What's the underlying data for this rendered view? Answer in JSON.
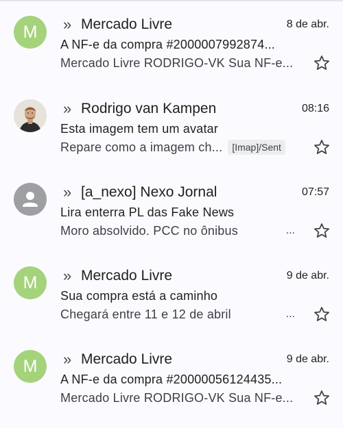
{
  "emails": [
    {
      "avatar_letter": "M",
      "forward_glyph": "»",
      "sender": "Mercado Livre",
      "date": "8 de abr.",
      "subject": "A NF-e da compra #2000007992874...",
      "snippet": "Mercado Livre RODRIGO-VK Sua NF-e...",
      "icon": "star-outline-icon"
    },
    {
      "forward_glyph": "»",
      "sender": "Rodrigo van Kampen",
      "date": "08:16",
      "subject": "Esta imagem tem um avatar",
      "snippet": "Repare como a imagem ch...",
      "label": "[Imap]/Sent",
      "icon": "star-outline-icon"
    },
    {
      "forward_glyph": "»",
      "sender": "[a_nexo] Nexo Jornal",
      "date": "07:57",
      "subject": "Lira enterra PL das Fake News",
      "snippet": "Moro absolvido. PCC no ônibus",
      "ellipsis": "...",
      "icon": "star-outline-icon"
    },
    {
      "avatar_letter": "M",
      "forward_glyph": "»",
      "sender": "Mercado Livre",
      "date": "9 de abr.",
      "subject": "Sua compra está a caminho",
      "snippet": "Chegará entre 11 e 12 de abril",
      "ellipsis": "...",
      "icon": "star-outline-icon"
    },
    {
      "avatar_letter": "M",
      "forward_glyph": "»",
      "sender": "Mercado Livre",
      "date": "9 de abr.",
      "subject": "A NF-e da compra #20000056124435...",
      "snippet": "Mercado Livre RODRIGO-VK Sua NF-e...",
      "icon": "star-outline-icon"
    }
  ],
  "colors": {
    "letter_avatar_bg": "#a4d37c",
    "generic_avatar_bg": "#9e9fa3",
    "background": "#fbfbff"
  }
}
